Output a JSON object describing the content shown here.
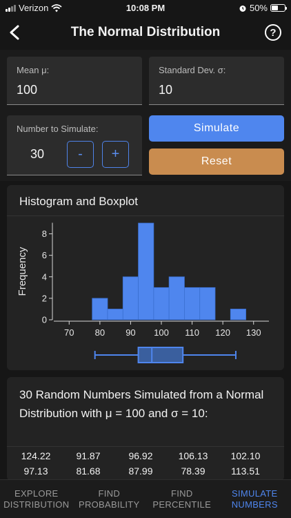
{
  "status": {
    "carrier": "Verizon",
    "time": "10:08 PM",
    "battery": "50%"
  },
  "nav": {
    "title": "The Normal Distribution",
    "help": "?"
  },
  "inputs": {
    "mean_label": "Mean μ:",
    "mean_value": "100",
    "sd_label": "Standard Dev. σ:",
    "sd_value": "10",
    "count_label": "Number to Simulate:",
    "count_value": "30",
    "minus": "-",
    "plus": "+"
  },
  "buttons": {
    "simulate": "Simulate",
    "reset": "Reset"
  },
  "colors": {
    "accent": "#4f86ee",
    "simulate": "#4f86ee",
    "reset": "#c98c4f",
    "bar": "#4f86ee"
  },
  "chart_title": "Histogram and Boxplot",
  "chart_data": {
    "type": "bar",
    "title": "Histogram and Boxplot",
    "ylabel": "Frequency",
    "xlabel": "",
    "xticks": [
      70,
      80,
      90,
      100,
      110,
      120,
      130
    ],
    "yticks": [
      0,
      2,
      4,
      6,
      8
    ],
    "xlim": [
      65,
      135
    ],
    "ylim": [
      0,
      9
    ],
    "bins": [
      {
        "x0": 77.5,
        "x1": 82.5,
        "count": 2
      },
      {
        "x0": 82.5,
        "x1": 87.5,
        "count": 1
      },
      {
        "x0": 87.5,
        "x1": 92.5,
        "count": 4
      },
      {
        "x0": 92.5,
        "x1": 97.5,
        "count": 9
      },
      {
        "x0": 97.5,
        "x1": 102.5,
        "count": 3
      },
      {
        "x0": 102.5,
        "x1": 107.5,
        "count": 4
      },
      {
        "x0": 107.5,
        "x1": 112.5,
        "count": 3
      },
      {
        "x0": 112.5,
        "x1": 117.5,
        "count": 3
      },
      {
        "x0": 122.5,
        "x1": 127.5,
        "count": 1
      }
    ],
    "boxplot": {
      "min": 78.39,
      "q1": 92.5,
      "median": 96.9,
      "q3": 107,
      "max": 124.22
    }
  },
  "results": {
    "title": "30 Random Numbers Simulated from a Normal Distribution with μ = 100 and σ = 10:",
    "numbers": [
      "124.22",
      "91.87",
      "96.92",
      "106.13",
      "102.10",
      "97.13",
      "81.68",
      "87.99",
      "78.39",
      "113.51"
    ]
  },
  "tabs": [
    {
      "line1": "EXPLORE",
      "line2": "DISTRIBUTION"
    },
    {
      "line1": "FIND",
      "line2": "PROBABILITY"
    },
    {
      "line1": "FIND",
      "line2": "PERCENTILE"
    },
    {
      "line1": "SIMULATE",
      "line2": "NUMBERS"
    }
  ]
}
